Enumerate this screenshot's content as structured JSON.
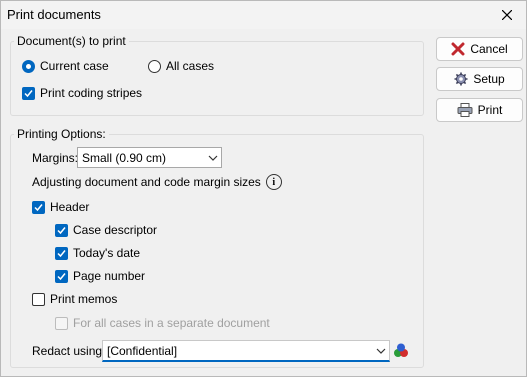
{
  "window": {
    "title": "Print documents"
  },
  "documents_group": {
    "title": "Document(s) to print",
    "current_case": "Current case",
    "all_cases": "All cases",
    "print_coding_stripes": "Print coding stripes"
  },
  "buttons": {
    "cancel": "Cancel",
    "setup": "Setup",
    "print": "Print"
  },
  "options_group": {
    "title": "Printing Options:",
    "margins_label": "Margins:",
    "margins_value": "Small (0.90 cm)",
    "adjust_text": "Adjusting document and code margin sizes",
    "header": "Header",
    "case_descriptor": "Case descriptor",
    "todays_date": "Today's date",
    "page_number": "Page number",
    "print_memos": "Print memos",
    "for_all_cases": "For all cases in a separate document",
    "redact_label": "Redact using:",
    "redact_value": "[Confidential]"
  },
  "colors": {
    "accent": "#0067c0",
    "cancel_icon": "#c0282e"
  }
}
